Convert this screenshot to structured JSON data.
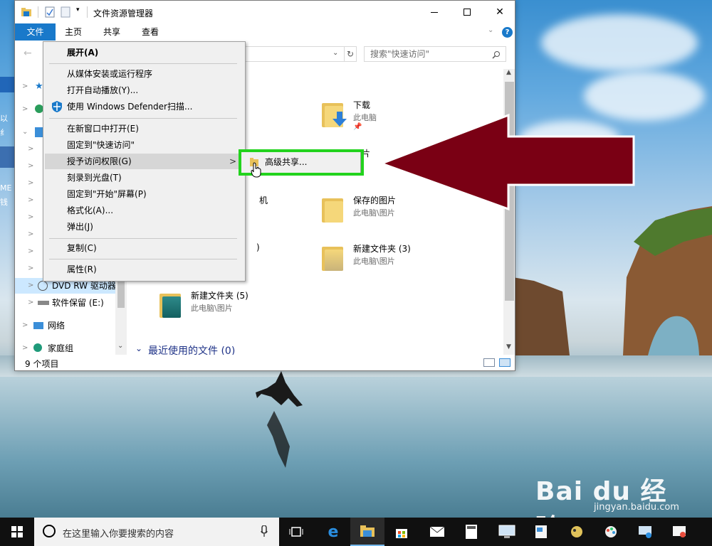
{
  "window": {
    "title": "文件资源管理器",
    "tabs": [
      "文件",
      "主页",
      "共享",
      "查看"
    ]
  },
  "search": {
    "placeholder": "搜索\"快速访问\""
  },
  "nav": {
    "items": [
      {
        "label": "DVD RW 驱动器"
      },
      {
        "label": "软件保留 (E:)"
      },
      {
        "label": "网络"
      },
      {
        "label": "家庭组"
      }
    ]
  },
  "content": {
    "items": [
      {
        "name": "下载",
        "path": "此电脑",
        "icon": "download-folder-icon",
        "pinned": true
      },
      {
        "name": "图片",
        "path": "此电脑",
        "icon": "pictures-folder-icon",
        "pinned": true
      },
      {
        "name": "保存的图片",
        "path": "此电脑\\图片",
        "icon": "folder-icon"
      },
      {
        "name": "新建文件夹 (3)",
        "path": "此电脑\\图片",
        "icon": "folder-icon"
      },
      {
        "name": "新建文件夹 (5)",
        "path": "此电脑\\图片",
        "icon": "folder-icon"
      }
    ],
    "partial_label_1": "机",
    "partial_label_2": ")",
    "recent_header": "最近使用的文件 (0)"
  },
  "status": {
    "count": "9 个项目"
  },
  "context_menu": {
    "items": [
      {
        "label": "展开(A)",
        "bold": true
      },
      {
        "label": "从媒体安装或运行程序"
      },
      {
        "label": "打开自动播放(Y)..."
      },
      {
        "label": "使用 Windows Defender扫描..."
      },
      {
        "label": "在新窗口中打开(E)"
      },
      {
        "label": "固定到\"快速访问\""
      },
      {
        "label": "授予访问权限(G)",
        "highlighted": true,
        "has_submenu": true
      },
      {
        "label": "刻录到光盘(T)"
      },
      {
        "label": "固定到\"开始\"屏幕(P)"
      },
      {
        "label": "格式化(A)..."
      },
      {
        "label": "弹出(J)"
      },
      {
        "label": "复制(C)"
      },
      {
        "label": "属性(R)"
      }
    ]
  },
  "submenu": {
    "item": "高级共享..."
  },
  "taskbar": {
    "search_text": "在这里输入你要搜索的内容"
  },
  "watermark": {
    "logo": "Bai du 经验",
    "url": "jingyan.baidu.com"
  },
  "desktop_fragments": [
    "以",
    "纟",
    "ME",
    "钱"
  ],
  "colors": {
    "accent": "#1979ca",
    "highlight_frame": "#22d31d",
    "annotation_arrow": "#7a0014"
  }
}
